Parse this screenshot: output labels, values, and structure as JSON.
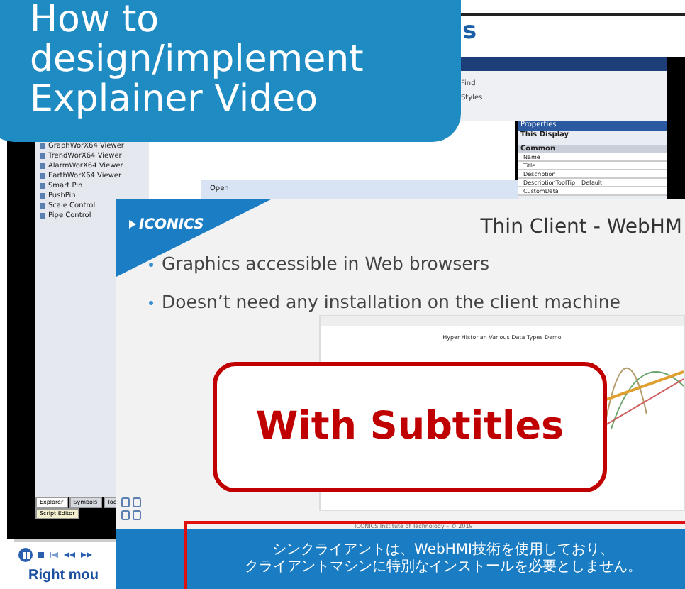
{
  "overlay_title": {
    "lines": [
      "How to",
      "design/implement",
      "Explainer Video"
    ]
  },
  "page_heading": "s",
  "app": {
    "ribbon": [
      {
        "label": "Find"
      },
      {
        "label": "Styles"
      }
    ],
    "toolbox_items": [
      "GraphWorX64 Viewer",
      "TrendWorX64 Viewer",
      "AlarmWorX64 Viewer",
      "EarthWorX64 Viewer",
      "Smart Pin",
      "PushPin",
      "Scale Control",
      "Pipe Control"
    ],
    "dialog_title": "Open",
    "properties": {
      "title": "Properties",
      "display": "This Display",
      "section": "Common",
      "rows": [
        {
          "name": "Name"
        },
        {
          "name": "Title"
        },
        {
          "name": "Description"
        },
        {
          "name": "DescriptionToolTip",
          "value": "Default"
        },
        {
          "name": "CustomData"
        }
      ]
    },
    "bottom_tabs": [
      {
        "label": "Explorer",
        "selected": true
      },
      {
        "label": "Symbols",
        "selected": false
      },
      {
        "label": "Too",
        "selected": false
      }
    ],
    "script_tab": "Script Editor"
  },
  "slide": {
    "logo": "ICONICS",
    "title": "Thin Client - WebHM",
    "bullets": [
      "Graphics accessible in Web browsers",
      "Doesn’t need any installation on the client machine"
    ],
    "embedded": {
      "title": "Hyper Historian Various Data Types Demo"
    },
    "footer": "ICONICS Institute of Technology – © 2019"
  },
  "badge": "With Subtitles",
  "subtitle": [
    "シンクライアントは、WebHMI技術を使用しており、",
    "クライアントマシンに特別なインストールを必要としません。"
  ],
  "player": {
    "playing": true
  },
  "caption": "Right mou"
}
